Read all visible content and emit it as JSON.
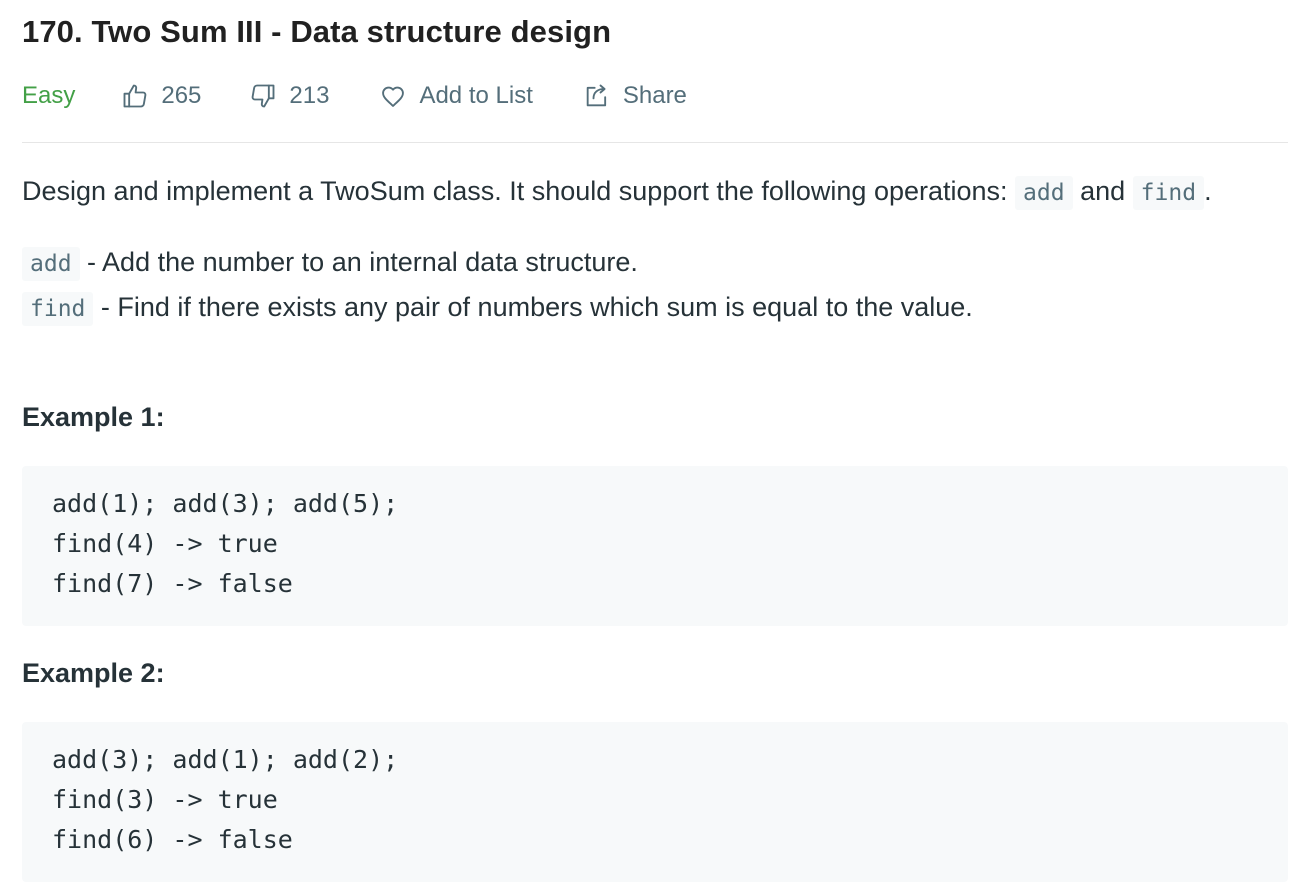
{
  "problem": {
    "title": "170. Two Sum III - Data structure design",
    "difficulty": "Easy",
    "likes": "265",
    "dislikes": "213",
    "add_to_list": "Add to List",
    "share": "Share"
  },
  "description": {
    "intro_before": "Design and implement a TwoSum class. It should support the following operations: ",
    "code_add": "add",
    "intro_and": " and",
    "code_find": "find",
    "intro_end": ".",
    "add_desc": " - Add the number to an internal data structure.",
    "find_desc": " - Find if there exists any pair of numbers which sum is equal to the value."
  },
  "examples": [
    {
      "heading": "Example 1:",
      "lines": [
        "add(1); add(3); add(5);",
        "find(4) -> true",
        "find(7) -> false"
      ]
    },
    {
      "heading": "Example 2:",
      "lines": [
        "add(3); add(1); add(2);",
        "find(3) -> true",
        "find(6) -> false"
      ]
    }
  ],
  "colors": {
    "difficulty_easy": "#43a047",
    "meta_text": "#546e7a",
    "code_bg": "#f7f9fa"
  },
  "icons": {
    "likes": "thumbs-up-icon",
    "dislikes": "thumbs-down-icon",
    "add_to_list": "heart-icon",
    "share": "share-icon"
  }
}
